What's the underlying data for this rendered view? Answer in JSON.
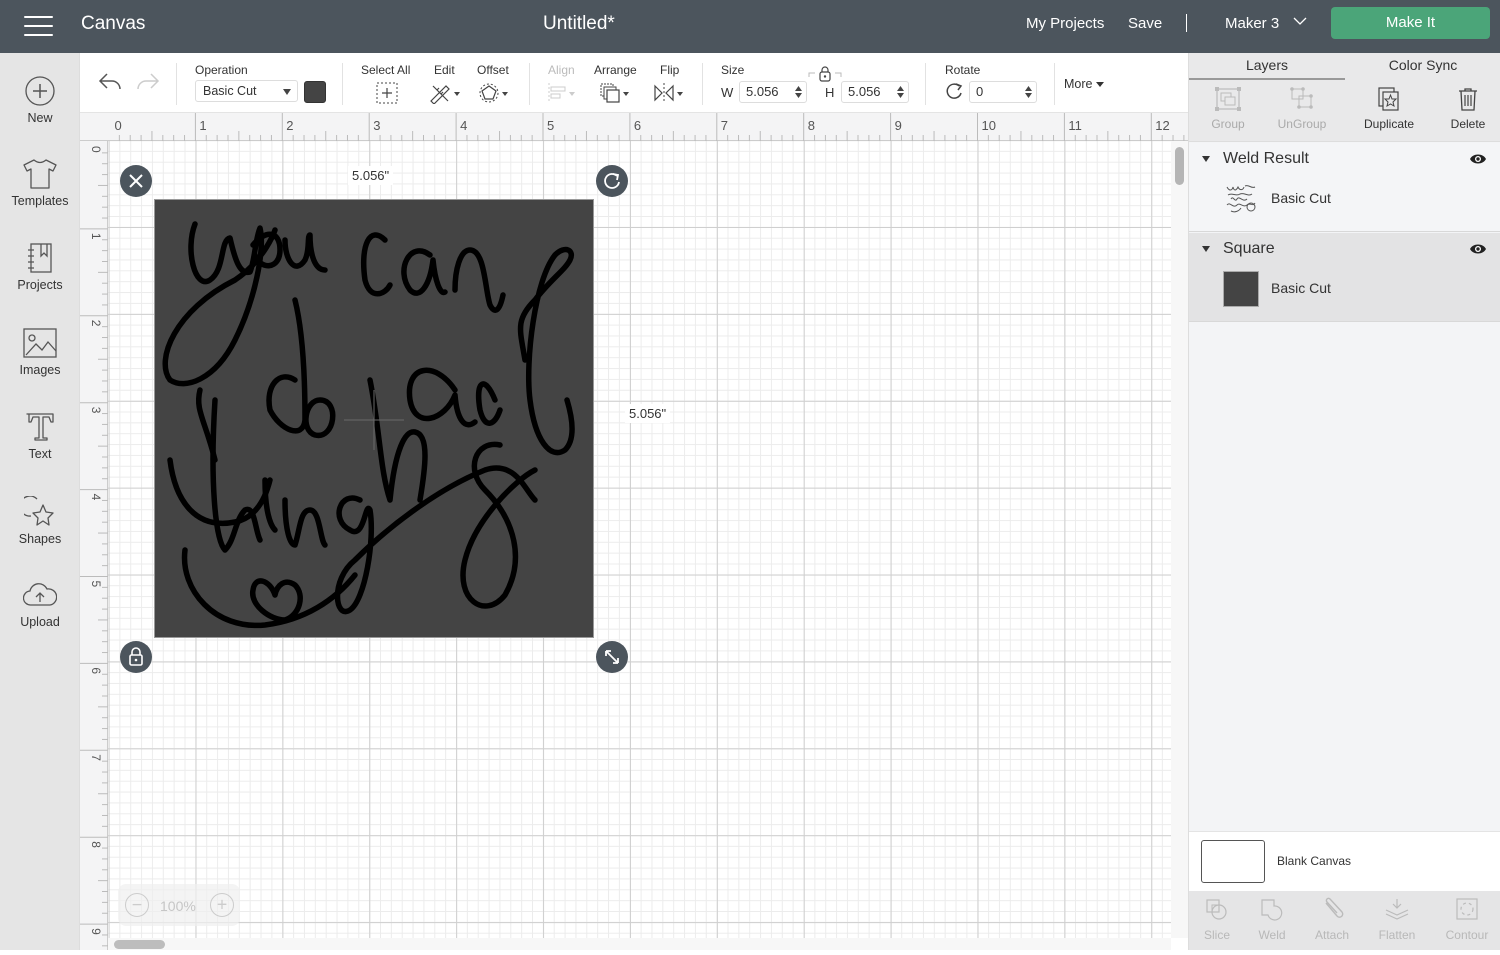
{
  "header": {
    "menu_icon": "hamburger-menu-icon",
    "app_name": "Canvas",
    "document_title": "Untitled*",
    "my_projects": "My Projects",
    "save": "Save",
    "machine": "Maker 3",
    "make_it": "Make It",
    "make_it_color": "#4ba579"
  },
  "sidebar": {
    "items": [
      {
        "label": "New",
        "icon": "plus-circle-icon"
      },
      {
        "label": "Templates",
        "icon": "tshirt-icon"
      },
      {
        "label": "Projects",
        "icon": "notebook-icon"
      },
      {
        "label": "Images",
        "icon": "image-icon"
      },
      {
        "label": "Text",
        "icon": "text-t-icon"
      },
      {
        "label": "Shapes",
        "icon": "shapes-icon"
      },
      {
        "label": "Upload",
        "icon": "cloud-upload-icon"
      }
    ]
  },
  "toolbar": {
    "operation_label": "Operation",
    "operation_value": "Basic Cut",
    "operation_color": "#444444",
    "select_all": "Select All",
    "edit": "Edit",
    "offset": "Offset",
    "align": "Align",
    "arrange": "Arrange",
    "flip": "Flip",
    "size_label": "Size",
    "w_label": "W",
    "w_value": "5.056",
    "h_label": "H",
    "h_value": "5.056",
    "rotate_label": "Rotate",
    "rotate_value": "0",
    "more": "More"
  },
  "rulers": {
    "top": [
      "0",
      "1",
      "2",
      "3",
      "4",
      "5",
      "6",
      "7",
      "8",
      "9",
      "10",
      "11",
      "12"
    ],
    "left": [
      "0",
      "1",
      "2",
      "3",
      "4",
      "5",
      "6",
      "7",
      "8",
      "9"
    ]
  },
  "canvas": {
    "width_label": "5.056\"",
    "height_label": "5.056\"",
    "design_text": "you can do hard things",
    "design_bg_color": "#444444",
    "zoom_level": "100%"
  },
  "right_panel": {
    "tabs": [
      {
        "label": "Layers",
        "active": true
      },
      {
        "label": "Color Sync",
        "active": false
      }
    ],
    "actions": [
      {
        "label": "Group",
        "enabled": false
      },
      {
        "label": "UnGroup",
        "enabled": false
      },
      {
        "label": "Duplicate",
        "enabled": true
      },
      {
        "label": "Delete",
        "enabled": true
      }
    ],
    "layers": [
      {
        "title": "Weld Result",
        "item_label": "Basic Cut",
        "visible": true
      },
      {
        "title": "Square",
        "item_label": "Basic Cut",
        "visible": true
      }
    ],
    "blank_canvas": "Blank Canvas",
    "bottom_actions": [
      "Slice",
      "Weld",
      "Attach",
      "Flatten",
      "Contour"
    ]
  }
}
